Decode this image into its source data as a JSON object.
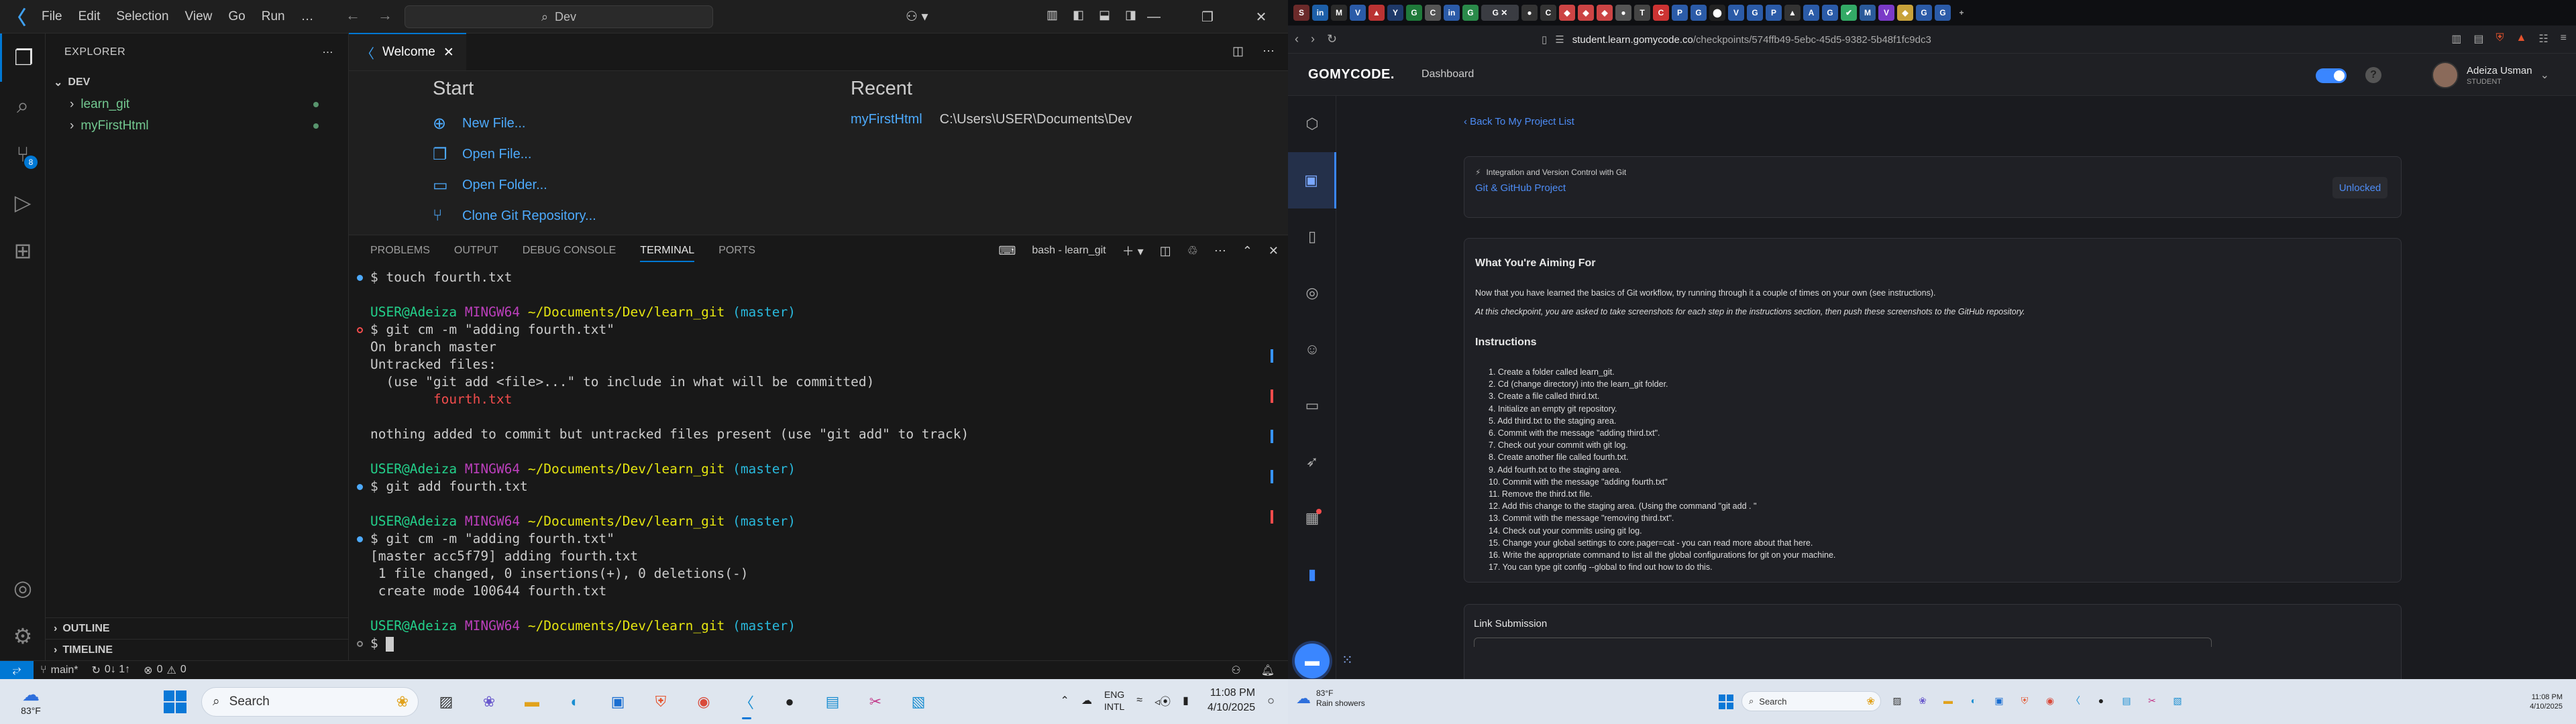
{
  "vscode": {
    "menu": [
      "File",
      "Edit",
      "Selection",
      "View",
      "Go",
      "Run",
      "…"
    ],
    "command_center": "Dev",
    "explorer": {
      "title": "EXPLORER",
      "root": "DEV",
      "items": [
        {
          "label": "learn_git"
        },
        {
          "label": "myFirstHtml"
        }
      ],
      "outline": "OUTLINE",
      "timeline": "TIMELINE"
    },
    "activity_badge": "8",
    "tab": {
      "label": "Welcome"
    },
    "welcome": {
      "start_title": "Start",
      "start_links": [
        "New File...",
        "Open File...",
        "Open Folder...",
        "Clone Git Repository..."
      ],
      "recent_title": "Recent",
      "recent": [
        {
          "name": "myFirstHtml",
          "path": "C:\\Users\\USER\\Documents\\Dev"
        }
      ]
    },
    "panel": {
      "tabs": [
        "PROBLEMS",
        "OUTPUT",
        "DEBUG CONSOLE",
        "TERMINAL",
        "PORTS"
      ],
      "active_tab": "TERMINAL",
      "terminal_name": "bash - learn_git"
    },
    "terminal": {
      "user": "USER@Adeiza",
      "host": "MINGW64",
      "path": "~/Documents/Dev/learn_git",
      "branch": "(master)",
      "line1": "$ touch fourth.txt",
      "cmd2": "$ git cm -m \"adding fourth.txt\"",
      "out2a": "On branch master",
      "out2b": "Untracked files:",
      "out2c": "  (use \"git add <file>...\" to include in what will be committed)",
      "out2d": "        fourth.txt",
      "out2e": "nothing added to commit but untracked files present (use \"git add\" to track)",
      "cmd3": "$ git add fourth.txt",
      "cmd4": "$ git cm -m \"adding fourth.txt\"",
      "out4a": "[master acc5f79] adding fourth.txt",
      "out4b": " 1 file changed, 0 insertions(+), 0 deletions(-)",
      "out4c": " create mode 100644 fourth.txt",
      "prompt": "$ "
    },
    "status": {
      "branch": "main*",
      "sync": "0↓ 1↑",
      "errors": "0",
      "warnings": "0"
    }
  },
  "browser": {
    "url_host": "student.learn.gomycode.co",
    "url_path": "/checkpoints/574ffb49-5ebc-45d5-9382-5b48f1fc9dc3",
    "site": {
      "logo": "GOMYCODE.",
      "nav": "Dashboard",
      "user_name": "Adeiza Usman",
      "user_role": "STUDENT"
    },
    "back_link": "‹  Back To My Project List",
    "module": "Integration and Version Control with Git",
    "project": "Git & GitHub Project",
    "status_badge": "Unlocked",
    "aim_title": "What You're Aiming For",
    "aim_text": "Now that you have learned the basics of Git workflow, try running through it a couple of times on your own (see instructions).",
    "aim_note": "At this checkpoint, you are asked to take screenshots for each step in the instructions section, then push these screenshots to the GitHub repository.",
    "instructions_title": "Instructions",
    "instructions": [
      "1. Create a folder called learn_git.",
      "2. Cd (change directory) into the learn_git folder.",
      "3. Create a file called third.txt.",
      "4. Initialize an empty git repository.",
      "5. Add third.txt to the staging area.",
      "6. Commit with the message \"adding third.txt\".",
      "7. Check out your commit with git log.",
      "8. Create another file called fourth.txt.",
      "9. Add fourth.txt to the staging area.",
      "10. Commit with the message \"adding fourth.txt\"",
      "11. Remove the third.txt file.",
      "12. Add this change to the staging area. (Using the command \"git add . \"",
      "13. Commit with the message \"removing third.txt\".",
      "14. Check out your commits using git log.",
      "15. Change your global settings to core.pager=cat - you can read more about that here.",
      "16. Write the appropriate command to list all the global configurations for git on your machine.",
      "17. You can type git config --global to find out how to do this."
    ],
    "submission_title": "Link Submission"
  },
  "taskbar": {
    "temp": "83°F",
    "search": "Search",
    "lang1": "ENG",
    "lang2": "INTL",
    "time": "11:08 PM",
    "date": "4/10/2025"
  },
  "taskbar2": {
    "temp": "83°F",
    "weather": "Rain showers",
    "search": "Search",
    "time": "11:08 PM",
    "date": "4/10/2025"
  }
}
